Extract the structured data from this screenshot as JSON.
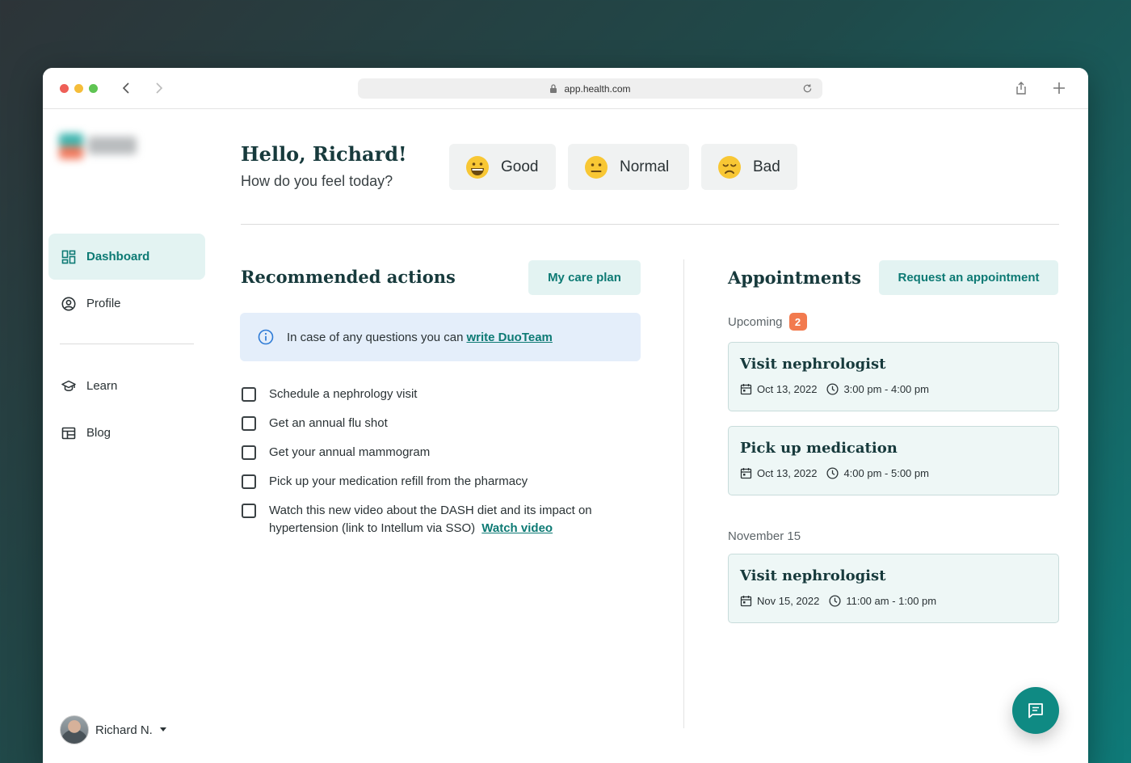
{
  "browser": {
    "url": "app.health.com"
  },
  "sidebar": {
    "items": [
      {
        "label": "Dashboard",
        "icon": "dashboard-icon",
        "active": true
      },
      {
        "label": "Profile",
        "icon": "user-circle-icon",
        "active": false
      },
      {
        "label": "Learn",
        "icon": "graduation-cap-icon",
        "active": false
      },
      {
        "label": "Blog",
        "icon": "layout-icon",
        "active": false
      }
    ],
    "user": {
      "name": "Richard N."
    }
  },
  "greeting": {
    "title": "Hello, Richard!",
    "subtitle": "How do you feel today?"
  },
  "moods": [
    {
      "label": "Good",
      "icon": "grinning-face-icon"
    },
    {
      "label": "Normal",
      "icon": "neutral-face-icon"
    },
    {
      "label": "Bad",
      "icon": "disappointed-face-icon"
    }
  ],
  "recommended": {
    "title": "Recommended actions",
    "care_plan_button": "My care plan",
    "info_text": "In case of any questions you can",
    "info_link": "write DuoTeam",
    "todos": [
      "Schedule a nephrology visit",
      "Get an annual flu shot",
      "Get your annual mammogram",
      "Pick up your medication refill from the pharmacy",
      "Watch this new video about the DASH diet and its impact on hypertension (link to Intellum via SSO)"
    ],
    "todo_link": "Watch video"
  },
  "appointments": {
    "title": "Appointments",
    "request_button": "Request an appointment",
    "upcoming_label": "Upcoming",
    "upcoming_count": "2",
    "group2_label": "November 15",
    "items": [
      {
        "name": "Visit nephrologist",
        "date": "Oct 13, 2022",
        "time": "3:00 pm - 4:00 pm"
      },
      {
        "name": "Pick up medication",
        "date": "Oct 13, 2022",
        "time": "4:00 pm - 5:00 pm"
      },
      {
        "name": "Visit nephrologist",
        "date": "Nov 15, 2022",
        "time": "11:00 am - 1:00 pm"
      }
    ]
  },
  "colors": {
    "accent": "#0d7a74",
    "accent_soft": "#e3f3f2",
    "badge": "#f27a4e",
    "info_bg": "#e4eefa"
  }
}
